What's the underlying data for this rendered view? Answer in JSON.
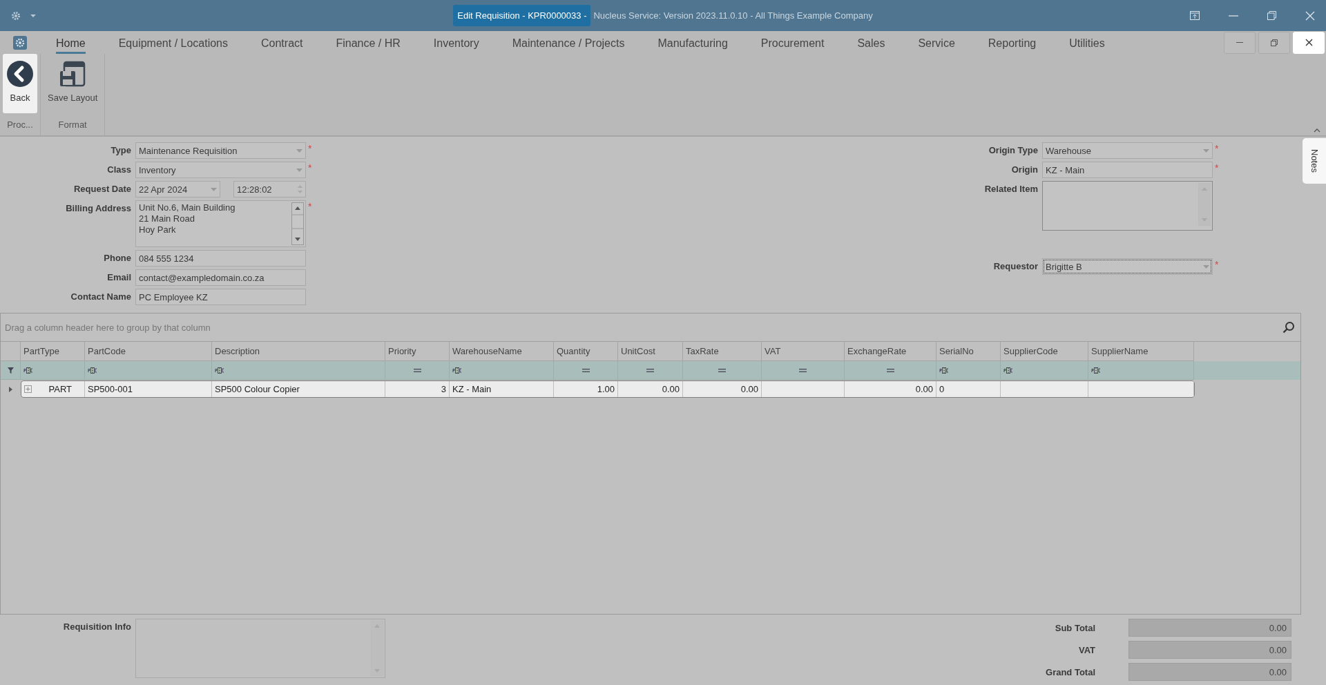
{
  "window": {
    "title_active": "Edit Requisition - KPR0000033 -",
    "title_rest": "Nucleus Service: Version 2023.11.0.10 - All Things Example Company"
  },
  "menu_tabs": [
    {
      "label": "Home",
      "selected": true
    },
    {
      "label": "Equipment / Locations",
      "selected": false
    },
    {
      "label": "Contract",
      "selected": false
    },
    {
      "label": "Finance / HR",
      "selected": false
    },
    {
      "label": "Inventory",
      "selected": false
    },
    {
      "label": "Maintenance / Projects",
      "selected": false
    },
    {
      "label": "Manufacturing",
      "selected": false
    },
    {
      "label": "Procurement",
      "selected": false
    },
    {
      "label": "Sales",
      "selected": false
    },
    {
      "label": "Service",
      "selected": false
    },
    {
      "label": "Reporting",
      "selected": false
    },
    {
      "label": "Utilities",
      "selected": false
    }
  ],
  "ribbon_groups": [
    {
      "label": "Proc...",
      "buttons": [
        {
          "label": "Back",
          "kind": "back",
          "selected": true
        }
      ]
    },
    {
      "label": "Format",
      "buttons": [
        {
          "label": "Save Layout",
          "kind": "save",
          "selected": false
        }
      ]
    }
  ],
  "form_left": [
    {
      "label": "Type",
      "kind": "combo",
      "value": "Maintenance Requisition",
      "marker": "*",
      "focused": false
    },
    {
      "label": "Class",
      "kind": "combo",
      "value": "Inventory",
      "marker": "*",
      "focused": false
    },
    {
      "label": "Request Date",
      "kind": "datetime",
      "value": "22 Apr 2024",
      "time": "12:28:02",
      "focused": false
    },
    {
      "label": "Billing Address",
      "kind": "memo",
      "lines": [
        "Unit No.6, Main Building",
        "21 Main Road",
        "Hoy Park"
      ],
      "marker": "*",
      "focused": false
    },
    {
      "label": "Phone",
      "kind": "text",
      "value": "084 555 1234",
      "focused": false
    },
    {
      "label": "Email",
      "kind": "text",
      "value": "contact@exampledomain.co.za",
      "focused": false
    },
    {
      "label": "Contact Name",
      "kind": "text",
      "value": "PC Employee KZ",
      "focused": false
    }
  ],
  "form_right": [
    {
      "label": "Origin Type",
      "kind": "combo",
      "value": "Warehouse",
      "marker": "*",
      "focused": false
    },
    {
      "label": "Origin",
      "kind": "text",
      "value": "KZ - Main",
      "marker": "*",
      "focused": false
    },
    {
      "label": "Related Item",
      "kind": "memo",
      "focused": false
    },
    {
      "label": "Requestor",
      "kind": "combo",
      "value": "Brigitte B",
      "marker": "*",
      "focused": true
    }
  ],
  "notes_tab": {
    "label": "Notes"
  },
  "grid": {
    "group_panel": {
      "placeholder": "Drag a column header here to group by that column"
    },
    "columns": [
      {
        "label": "PartType",
        "kind": "text"
      },
      {
        "label": "PartCode",
        "kind": "text"
      },
      {
        "label": "Description",
        "kind": "text"
      },
      {
        "label": "Priority",
        "kind": "number"
      },
      {
        "label": "WarehouseName",
        "kind": "text"
      },
      {
        "label": "Quantity",
        "kind": "number"
      },
      {
        "label": "UnitCost",
        "kind": "number"
      },
      {
        "label": "TaxRate",
        "kind": "number"
      },
      {
        "label": "VAT",
        "kind": "number"
      },
      {
        "label": "ExchangeRate",
        "kind": "number"
      },
      {
        "label": "SerialNo",
        "kind": "text"
      },
      {
        "label": "SupplierCode",
        "kind": "text"
      },
      {
        "label": "SupplierName",
        "kind": "text"
      }
    ],
    "rows": [
      {
        "expanded": false,
        "focused": true,
        "cells": [
          "PART",
          "SP500-001",
          "SP500 Colour Copier",
          "3",
          "KZ - Main",
          "1.00",
          "0.00",
          "0.00",
          null,
          "0.00",
          "0",
          null,
          null
        ]
      }
    ]
  },
  "requisition_info": {
    "label": "Requisition Info"
  },
  "totals": [
    {
      "label": "Sub Total",
      "value": "0.00"
    },
    {
      "label": "VAT",
      "value": "0.00"
    },
    {
      "label": "Grand Total",
      "value": "0.00"
    }
  ]
}
